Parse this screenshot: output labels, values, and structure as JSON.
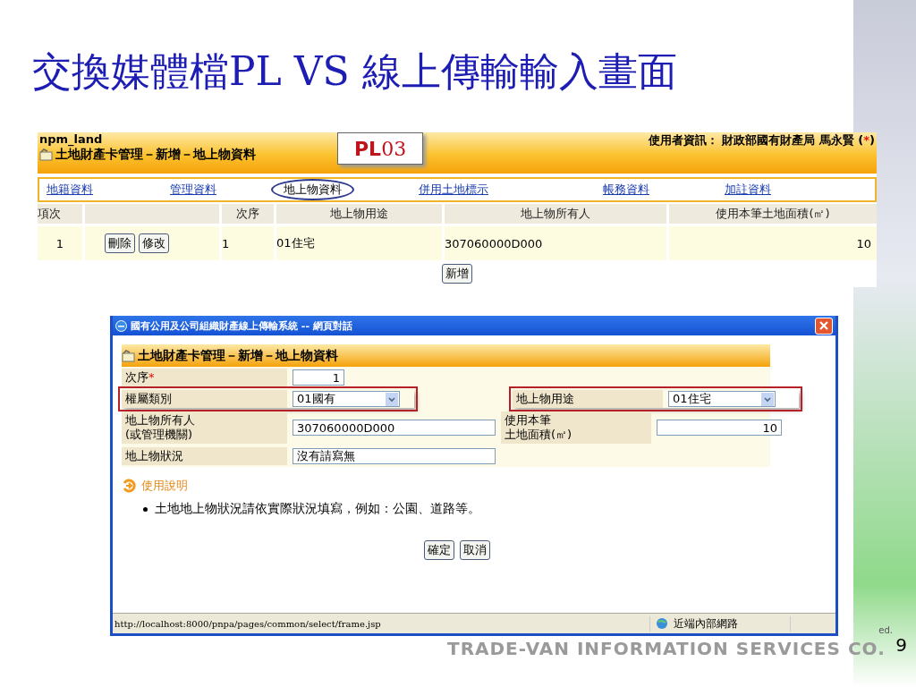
{
  "slide": {
    "title": "交換媒體檔PL VS 線上傳輸輸入畫面",
    "footer": "TRADE-VAN INFORMATION SERVICES CO.",
    "page_number": "9",
    "corner_text": "ed."
  },
  "page": {
    "app_name": "npm_land",
    "heading": "土地財產卡管理－新增－地上物資料",
    "badge": {
      "prefix": "PL",
      "suffix": "03"
    },
    "user_info": "使用者資訊： 財政部國有財產局  馬永賢 (",
    "required_mark": "*",
    "user_info_end": ")",
    "tabs": [
      {
        "label": "地籍資料",
        "selected": false
      },
      {
        "label": "管理資料",
        "selected": false
      },
      {
        "label": "地上物資料",
        "selected": true
      },
      {
        "label": "併用土地標示",
        "selected": false
      },
      {
        "label": "帳務資料",
        "selected": false
      },
      {
        "label": "加註資料",
        "selected": false
      }
    ],
    "table": {
      "columns": [
        "項次",
        "次序",
        "地上物用途",
        "地上物所有人",
        "使用本筆土地面積(㎡)"
      ],
      "rows": [
        {
          "index": "1",
          "buttons": [
            "刪除",
            "修改"
          ],
          "order": "1",
          "use": "01住宅",
          "owner": "307060000D000",
          "area": "10"
        }
      ]
    },
    "add_button": "新增"
  },
  "dialog": {
    "title": "國有公用及公司組織財產線上傳輸系統 -- 網頁對話",
    "heading": "土地財產卡管理－新增－地上物資料",
    "required_mark": "*",
    "rows": [
      [
        {
          "label": "次序",
          "required": true,
          "kind": "number",
          "value": "1",
          "highlighted": false
        }
      ],
      [
        {
          "label": "權屬類別",
          "required": false,
          "kind": "select",
          "value": "01國有",
          "highlighted": true
        },
        {
          "label": "地上物用途",
          "required": false,
          "kind": "select",
          "value": "01住宅",
          "highlighted": true
        }
      ],
      [
        {
          "label": [
            "地上物所有人",
            "(或管理機關)"
          ],
          "required": false,
          "kind": "text",
          "value": "307060000D000",
          "highlighted": false
        },
        {
          "label": [
            "使用本筆",
            "土地面積(㎡)"
          ],
          "required": false,
          "kind": "number",
          "value": "10",
          "highlighted": false
        }
      ],
      [
        {
          "label": "地上物狀況",
          "required": false,
          "kind": "wide",
          "value": "沒有請寫無",
          "highlighted": false
        }
      ]
    ],
    "help_title": "使用說明",
    "help_items": [
      "土地地上物狀況請依實際狀況填寫，例如：公園、道路等。"
    ],
    "buttons": [
      "確定",
      "取消"
    ],
    "status_url": "http://localhost:8000/pnpa/pages/common/select/frame.jsp",
    "zone": "近端內部網路"
  }
}
